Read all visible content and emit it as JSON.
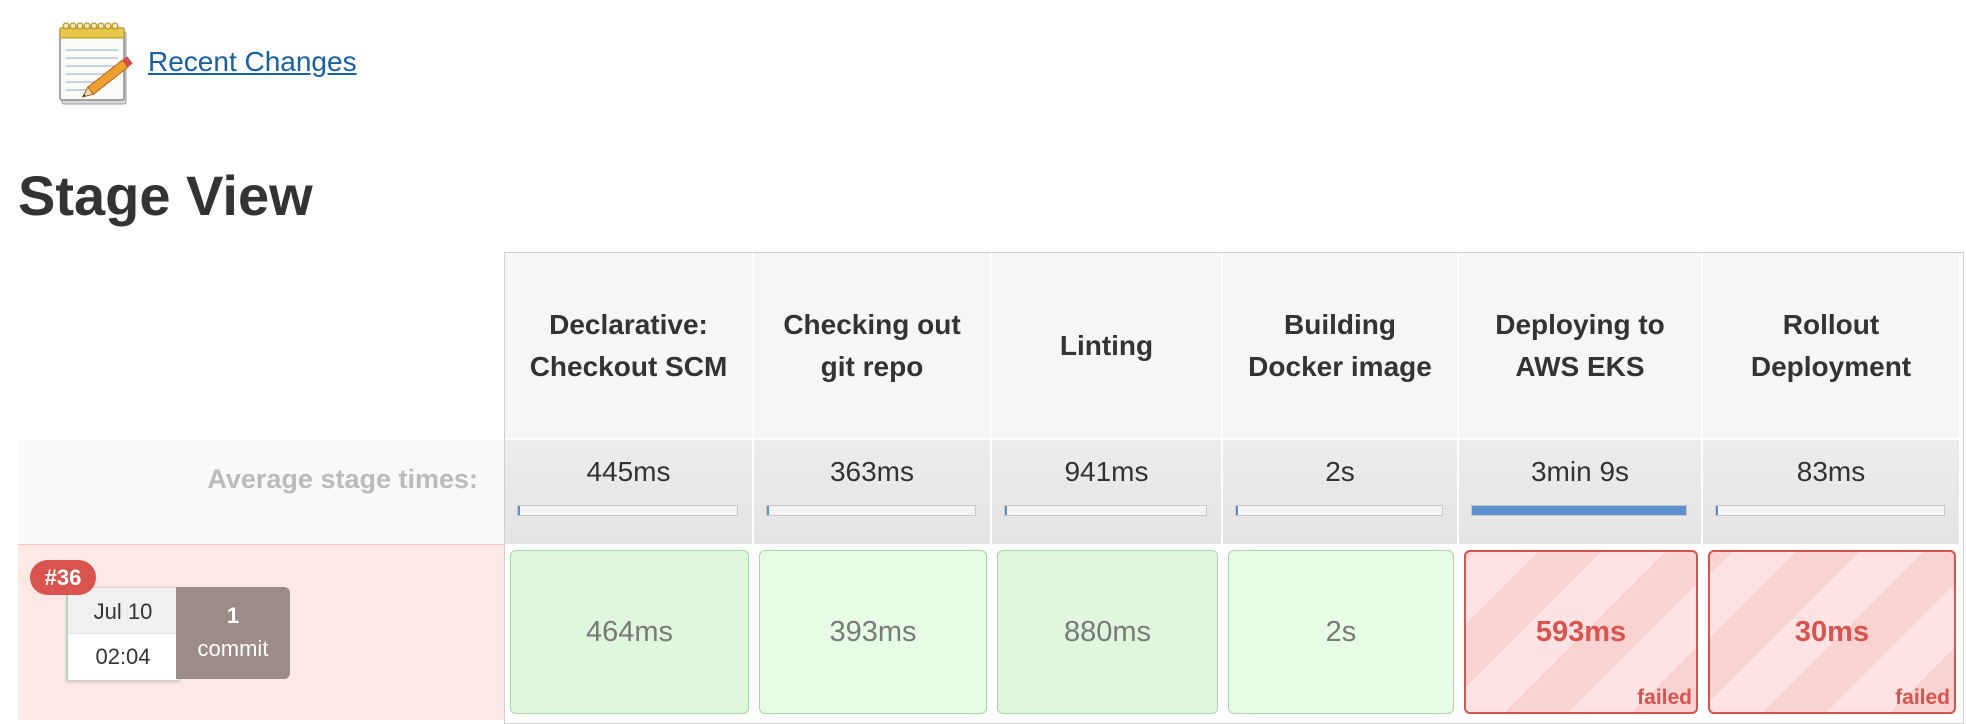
{
  "recent_changes": {
    "label": "Recent Changes",
    "icon": "notepad-icon"
  },
  "page_title": "Stage View",
  "average_label": "Average stage times:",
  "colors": {
    "success": "#dff7dc",
    "failed": "#d9534f",
    "progress": "#5b91cf",
    "link": "#1a5fa0"
  },
  "stages": [
    {
      "name": "Declarative: Checkout SCM",
      "avg": "445ms",
      "avg_fraction": 0.002
    },
    {
      "name": "Checking out git repo",
      "avg": "363ms",
      "avg_fraction": 0.002
    },
    {
      "name": "Linting",
      "avg": "941ms",
      "avg_fraction": 0.005
    },
    {
      "name": "Building Docker image",
      "avg": "2s",
      "avg_fraction": 0.011
    },
    {
      "name": "Deploying to AWS EKS",
      "avg": "3min 9s",
      "avg_fraction": 1.0
    },
    {
      "name": "Rollout Deployment",
      "avg": "83ms",
      "avg_fraction": 0.0004
    }
  ],
  "builds": [
    {
      "number": "#36",
      "date": "Jul 10",
      "time": "02:04",
      "commits_count": "1",
      "commits_label": "commit",
      "cells": [
        {
          "duration": "464ms",
          "status": "success",
          "status_label": ""
        },
        {
          "duration": "393ms",
          "status": "success",
          "status_label": ""
        },
        {
          "duration": "880ms",
          "status": "success",
          "status_label": ""
        },
        {
          "duration": "2s",
          "status": "success",
          "status_label": ""
        },
        {
          "duration": "593ms",
          "status": "failed",
          "status_label": "failed"
        },
        {
          "duration": "30ms",
          "status": "failed",
          "status_label": "failed"
        }
      ]
    }
  ]
}
